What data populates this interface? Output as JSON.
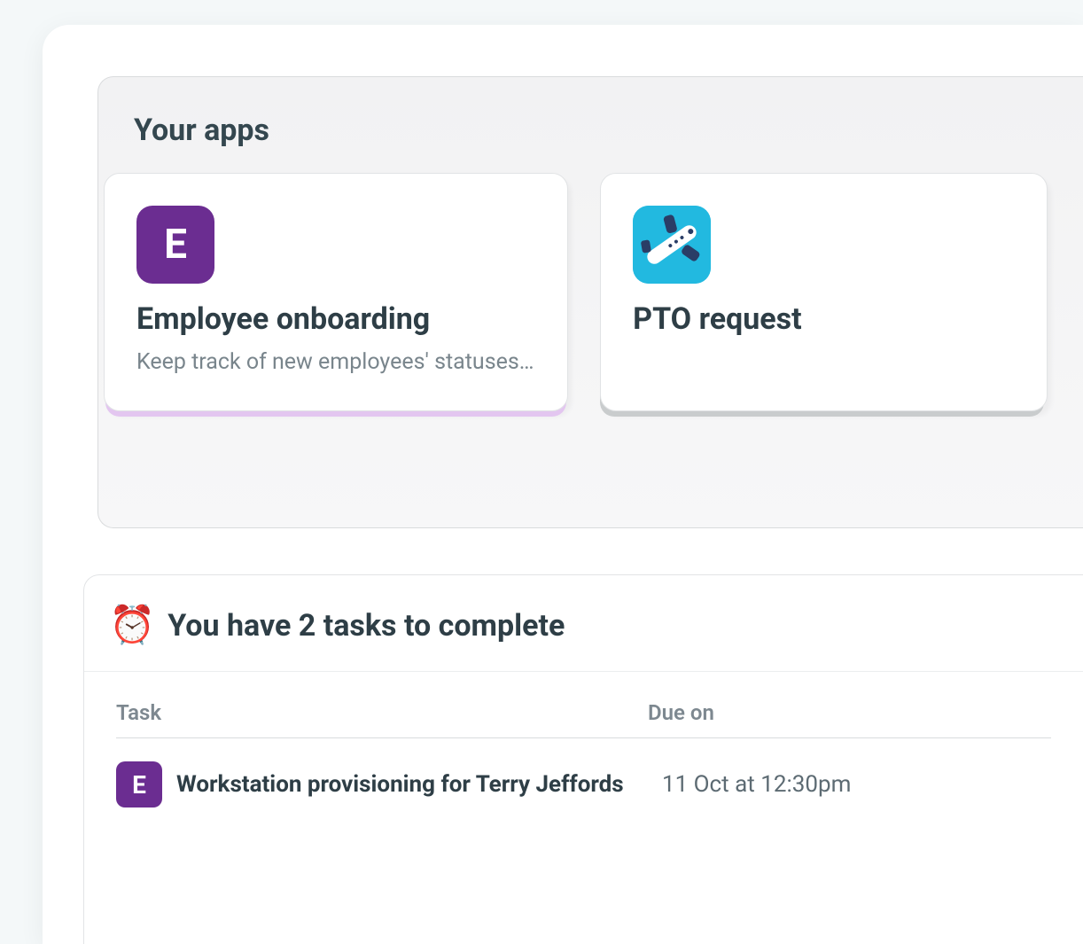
{
  "apps": {
    "title": "Your apps",
    "cards": [
      {
        "icon_letter": "E",
        "icon_name": "letter-e-icon",
        "icon_style": "purple",
        "title": "Employee onboarding",
        "description": "Keep track of new employees' statuses…"
      },
      {
        "icon_letter": "",
        "icon_name": "airplane-icon",
        "icon_style": "blue",
        "title": "PTO request",
        "description": ""
      }
    ]
  },
  "tasks": {
    "header_icon": "⏰",
    "header": "You have 2 tasks to complete",
    "columns": {
      "task": "Task",
      "due": "Due on"
    },
    "rows": [
      {
        "icon_letter": "E",
        "title": "Workstation provisioning for Terry Jeffords",
        "due": "11 Oct at 12:30pm"
      }
    ]
  }
}
